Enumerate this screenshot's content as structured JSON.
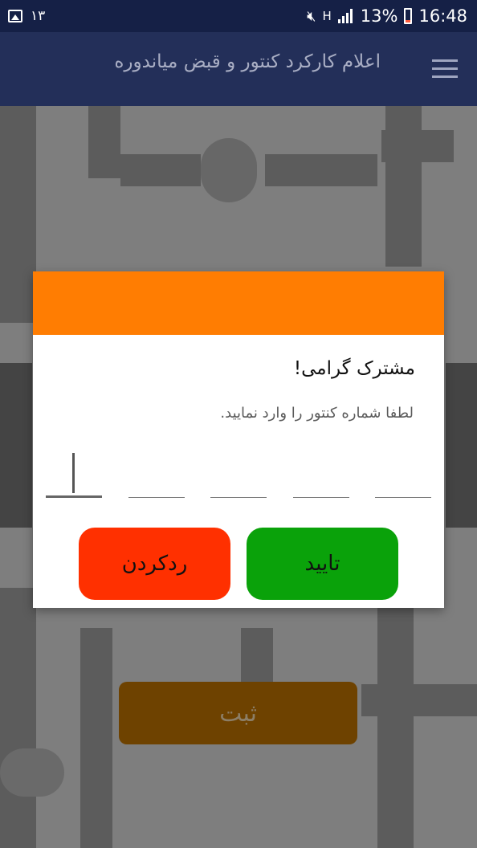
{
  "status_bar": {
    "notification_count": "۱۳",
    "battery_percent": "13%",
    "time": "16:48",
    "network_type": "H",
    "icons": [
      "image-icon",
      "mute-icon",
      "signal-icon",
      "battery-icon"
    ]
  },
  "app_bar": {
    "title": "اعلام کارکرد کنتور و قبض میاندوره",
    "menu_icon": "hamburger-menu-icon"
  },
  "dialog": {
    "header_color": "#ff7d02",
    "title": "مشترک گرامی!",
    "message": "لطفا شماره کنتور را وارد نمایید.",
    "code_inputs": [
      "",
      "",
      "",
      "",
      ""
    ],
    "confirm_label": "تایید",
    "reject_label": "ردکردن",
    "confirm_color": "#0aa20a",
    "reject_color": "#ff3000"
  },
  "background": {
    "submit_label": "ثبت"
  }
}
